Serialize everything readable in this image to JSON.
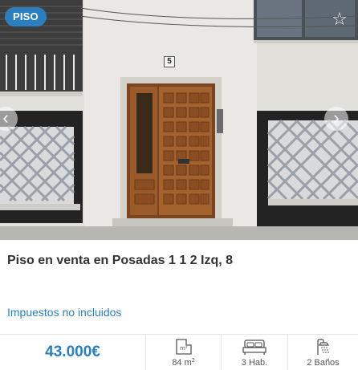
{
  "listing": {
    "badge": "PISO",
    "title": "Piso en venta en Posadas 1 1 2 Izq, 8",
    "taxes_note": "Impuestos no incluidos",
    "price": "43.000€",
    "features": {
      "area_value": "84 m",
      "area_unit_sup": "2",
      "rooms": "3 Hab.",
      "baths": "2 Baños"
    },
    "photo": {
      "house_number": "5"
    }
  },
  "icons": {
    "favorite": "star-outline-icon",
    "prev": "chevron-left-icon",
    "next": "chevron-right-icon",
    "area": "floor-plan-icon",
    "rooms": "bed-icon",
    "baths": "shower-icon"
  },
  "colors": {
    "accent": "#2b7fc0",
    "badge_bg": "#2b7fc0",
    "price": "#2b7fc0",
    "door_wood": "#9a5a2a"
  }
}
